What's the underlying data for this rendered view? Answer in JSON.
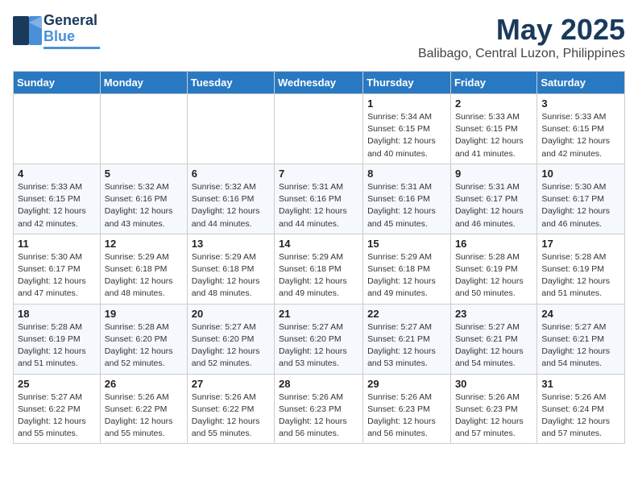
{
  "logo": {
    "line1": "General",
    "line2": "Blue"
  },
  "title": "May 2025",
  "subtitle": "Balibago, Central Luzon, Philippines",
  "days_of_week": [
    "Sunday",
    "Monday",
    "Tuesday",
    "Wednesday",
    "Thursday",
    "Friday",
    "Saturday"
  ],
  "weeks": [
    [
      {
        "day": "",
        "info": ""
      },
      {
        "day": "",
        "info": ""
      },
      {
        "day": "",
        "info": ""
      },
      {
        "day": "",
        "info": ""
      },
      {
        "day": "1",
        "info": "Sunrise: 5:34 AM\nSunset: 6:15 PM\nDaylight: 12 hours\nand 40 minutes."
      },
      {
        "day": "2",
        "info": "Sunrise: 5:33 AM\nSunset: 6:15 PM\nDaylight: 12 hours\nand 41 minutes."
      },
      {
        "day": "3",
        "info": "Sunrise: 5:33 AM\nSunset: 6:15 PM\nDaylight: 12 hours\nand 42 minutes."
      }
    ],
    [
      {
        "day": "4",
        "info": "Sunrise: 5:33 AM\nSunset: 6:15 PM\nDaylight: 12 hours\nand 42 minutes."
      },
      {
        "day": "5",
        "info": "Sunrise: 5:32 AM\nSunset: 6:16 PM\nDaylight: 12 hours\nand 43 minutes."
      },
      {
        "day": "6",
        "info": "Sunrise: 5:32 AM\nSunset: 6:16 PM\nDaylight: 12 hours\nand 44 minutes."
      },
      {
        "day": "7",
        "info": "Sunrise: 5:31 AM\nSunset: 6:16 PM\nDaylight: 12 hours\nand 44 minutes."
      },
      {
        "day": "8",
        "info": "Sunrise: 5:31 AM\nSunset: 6:16 PM\nDaylight: 12 hours\nand 45 minutes."
      },
      {
        "day": "9",
        "info": "Sunrise: 5:31 AM\nSunset: 6:17 PM\nDaylight: 12 hours\nand 46 minutes."
      },
      {
        "day": "10",
        "info": "Sunrise: 5:30 AM\nSunset: 6:17 PM\nDaylight: 12 hours\nand 46 minutes."
      }
    ],
    [
      {
        "day": "11",
        "info": "Sunrise: 5:30 AM\nSunset: 6:17 PM\nDaylight: 12 hours\nand 47 minutes."
      },
      {
        "day": "12",
        "info": "Sunrise: 5:29 AM\nSunset: 6:18 PM\nDaylight: 12 hours\nand 48 minutes."
      },
      {
        "day": "13",
        "info": "Sunrise: 5:29 AM\nSunset: 6:18 PM\nDaylight: 12 hours\nand 48 minutes."
      },
      {
        "day": "14",
        "info": "Sunrise: 5:29 AM\nSunset: 6:18 PM\nDaylight: 12 hours\nand 49 minutes."
      },
      {
        "day": "15",
        "info": "Sunrise: 5:29 AM\nSunset: 6:18 PM\nDaylight: 12 hours\nand 49 minutes."
      },
      {
        "day": "16",
        "info": "Sunrise: 5:28 AM\nSunset: 6:19 PM\nDaylight: 12 hours\nand 50 minutes."
      },
      {
        "day": "17",
        "info": "Sunrise: 5:28 AM\nSunset: 6:19 PM\nDaylight: 12 hours\nand 51 minutes."
      }
    ],
    [
      {
        "day": "18",
        "info": "Sunrise: 5:28 AM\nSunset: 6:19 PM\nDaylight: 12 hours\nand 51 minutes."
      },
      {
        "day": "19",
        "info": "Sunrise: 5:28 AM\nSunset: 6:20 PM\nDaylight: 12 hours\nand 52 minutes."
      },
      {
        "day": "20",
        "info": "Sunrise: 5:27 AM\nSunset: 6:20 PM\nDaylight: 12 hours\nand 52 minutes."
      },
      {
        "day": "21",
        "info": "Sunrise: 5:27 AM\nSunset: 6:20 PM\nDaylight: 12 hours\nand 53 minutes."
      },
      {
        "day": "22",
        "info": "Sunrise: 5:27 AM\nSunset: 6:21 PM\nDaylight: 12 hours\nand 53 minutes."
      },
      {
        "day": "23",
        "info": "Sunrise: 5:27 AM\nSunset: 6:21 PM\nDaylight: 12 hours\nand 54 minutes."
      },
      {
        "day": "24",
        "info": "Sunrise: 5:27 AM\nSunset: 6:21 PM\nDaylight: 12 hours\nand 54 minutes."
      }
    ],
    [
      {
        "day": "25",
        "info": "Sunrise: 5:27 AM\nSunset: 6:22 PM\nDaylight: 12 hours\nand 55 minutes."
      },
      {
        "day": "26",
        "info": "Sunrise: 5:26 AM\nSunset: 6:22 PM\nDaylight: 12 hours\nand 55 minutes."
      },
      {
        "day": "27",
        "info": "Sunrise: 5:26 AM\nSunset: 6:22 PM\nDaylight: 12 hours\nand 55 minutes."
      },
      {
        "day": "28",
        "info": "Sunrise: 5:26 AM\nSunset: 6:23 PM\nDaylight: 12 hours\nand 56 minutes."
      },
      {
        "day": "29",
        "info": "Sunrise: 5:26 AM\nSunset: 6:23 PM\nDaylight: 12 hours\nand 56 minutes."
      },
      {
        "day": "30",
        "info": "Sunrise: 5:26 AM\nSunset: 6:23 PM\nDaylight: 12 hours\nand 57 minutes."
      },
      {
        "day": "31",
        "info": "Sunrise: 5:26 AM\nSunset: 6:24 PM\nDaylight: 12 hours\nand 57 minutes."
      }
    ]
  ]
}
